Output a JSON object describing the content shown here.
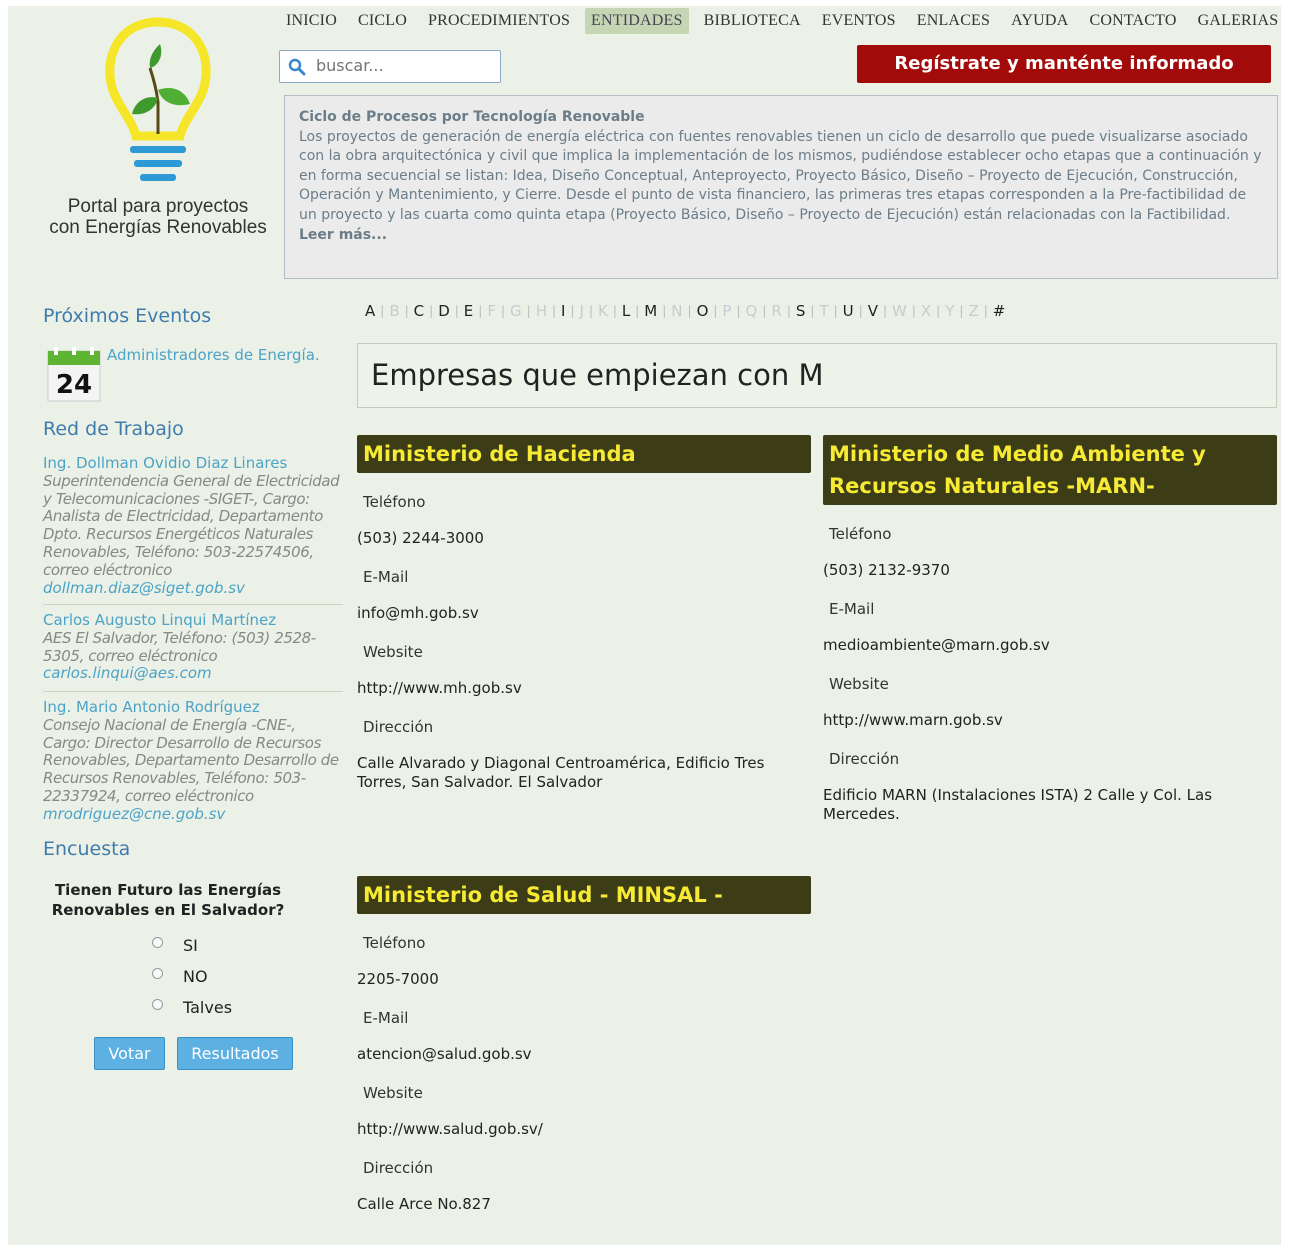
{
  "logo": {
    "line1": "Portal para proyectos",
    "line2": "con Energías Renovables"
  },
  "nav": {
    "items": [
      "INICIO",
      "CICLO",
      "PROCEDIMIENTOS",
      "ENTIDADES",
      "BIBLIOTECA",
      "EVENTOS",
      "ENLACES",
      "AYUDA",
      "CONTACTO",
      "GALERIAS"
    ],
    "active": "ENTIDADES"
  },
  "search": {
    "placeholder": "buscar..."
  },
  "register_label": "Regístrate y manténte informado",
  "intro": {
    "title": "Ciclo de Procesos por Tecnología Renovable",
    "body": "Los proyectos de generación de energía eléctrica con fuentes renovables tienen un ciclo de desarrollo que puede visualizarse asociado con la obra arquitectónica y civil que implica la implementación de los mismos, pudiéndose establecer ocho etapas que a continuación y en forma secuencial se listan: Idea, Diseño Conceptual, Anteproyecto, Proyecto Básico, Diseño – Proyecto de Ejecución, Construcción, Operación y Mantenimiento, y Cierre. Desde el punto de vista financiero, las primeras tres etapas corresponden a la Pre-factibilidad de un proyecto y las cuarta como quinta etapa (Proyecto Básico, Diseño – Proyecto de Ejecución) están relacionadas con la Factibilidad.",
    "more": "Leer más..."
  },
  "sidebar": {
    "events_heading": "Próximos Eventos",
    "event": {
      "day": "24",
      "title": "Administradores de Energía."
    },
    "network_heading": "Red de Trabajo",
    "contacts": [
      {
        "name": "Ing. Dollman Ovidio Diaz Linares",
        "desc": "Superintendencia General de Electricidad y Telecomunicaciones -SIGET-, Cargo: Analista de Electricidad, Departamento Dpto. Recursos Energéticos Naturales Renovables, Teléfono: 503-22574506, correo eléctronico",
        "email": "dollman.diaz@siget.gob.sv"
      },
      {
        "name": "Carlos Augusto Linqui Martínez",
        "desc": "AES El Salvador, Teléfono: (503) 2528-5305, correo eléctronico",
        "email": "carlos.linqui@aes.com"
      },
      {
        "name": "Ing. Mario Antonio Rodríguez",
        "desc": "Consejo Nacional de Energía -CNE-, Cargo: Director Desarrollo de Recursos Renovables, Departamento Desarrollo de Recursos Renovables, Teléfono: 503-22337924, correo eléctronico",
        "email": "mrodriguez@cne.gob.sv"
      }
    ],
    "poll_heading": "Encuesta",
    "poll_question": "Tienen Futuro las Energías Renovables en El Salvador?",
    "poll_options": [
      "SI",
      "NO",
      "Talves"
    ],
    "vote_label": "Votar",
    "results_label": "Resultados"
  },
  "alphabet": {
    "letters": [
      "A",
      "B",
      "C",
      "D",
      "E",
      "F",
      "G",
      "H",
      "I",
      "J",
      "K",
      "L",
      "M",
      "N",
      "O",
      "P",
      "Q",
      "R",
      "S",
      "T",
      "U",
      "V",
      "W",
      "X",
      "Y",
      "Z",
      "#"
    ],
    "enabled": [
      "A",
      "C",
      "D",
      "E",
      "I",
      "L",
      "M",
      "O",
      "S",
      "U",
      "V",
      "#"
    ]
  },
  "heading": "Empresas que empiezan con M",
  "labels": {
    "phone": "Teléfono",
    "email": "E-Mail",
    "website": "Website",
    "address": "Dirección"
  },
  "entities": [
    {
      "name": "Ministerio de Hacienda",
      "phone": "(503) 2244-3000",
      "email": "info@mh.gob.sv",
      "website": "http://www.mh.gob.sv",
      "address": "Calle Alvarado y Diagonal Centroamérica, Edificio Tres Torres, San Salvador. El Salvador"
    },
    {
      "name": "Ministerio de Medio Ambiente y Recursos Naturales -MARN-",
      "phone": "(503) 2132-9370",
      "email": "medioambiente@marn.gob.sv",
      "website": "http://www.marn.gob.sv",
      "address": "Edificio MARN (Instalaciones ISTA) 2 Calle y Col. Las Mercedes."
    },
    {
      "name": "Ministerio de Salud - MINSAL -",
      "phone": "2205-7000",
      "email": "atencion@salud.gob.sv",
      "website": "http://www.salud.gob.sv/",
      "address": "Calle Arce No.827"
    }
  ],
  "colors": {
    "page_bg": "#ebf1e6",
    "entity_title_bg": "#3c3c17",
    "entity_title_text": "#f6ea34",
    "register_bg": "#a30a0a",
    "link": "#4ca3c7",
    "sidebar_heading": "#3f7cae",
    "button": "#5db0e2"
  }
}
